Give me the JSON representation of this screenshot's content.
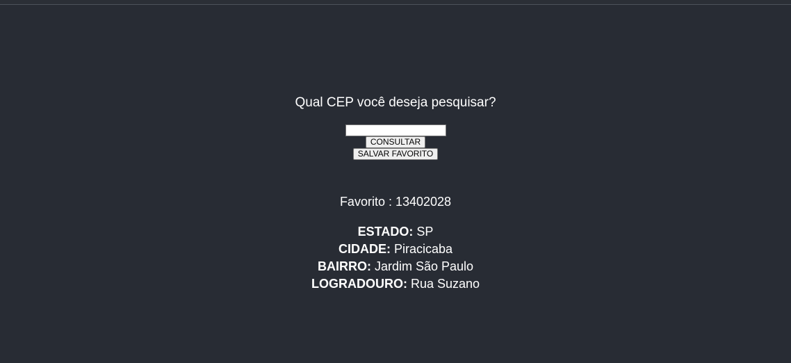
{
  "search": {
    "question": "Qual CEP você deseja pesquisar?",
    "input_value": "",
    "consult_label": "CONSULTAR",
    "save_favorite_label": "SALVAR FAVORITO"
  },
  "favorite": {
    "text": "Favorito : 13402028"
  },
  "address": {
    "estado_label": "ESTADO:",
    "estado_value": " SP",
    "cidade_label": "CIDADE:",
    "cidade_value": " Piracicaba",
    "bairro_label": "BAIRRO:",
    "bairro_value": " Jardim São Paulo",
    "logradouro_label": "LOGRADOURO:",
    "logradouro_value": " Rua Suzano"
  }
}
